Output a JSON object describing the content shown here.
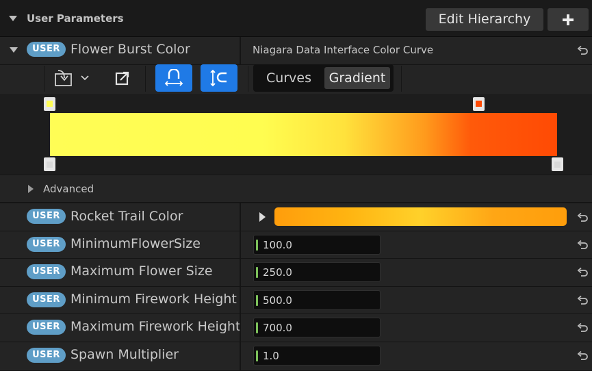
{
  "header": {
    "title": "User Parameters",
    "edit_hierarchy_label": "Edit Hierarchy",
    "add_icon": "plus-icon"
  },
  "badge_text": "USER",
  "flower_burst": {
    "label": "Flower Burst Color",
    "type_text": "Niagara Data Interface Color Curve",
    "tabs": [
      "Curves",
      "Gradient"
    ],
    "active_tab": "Gradient",
    "advanced_label": "Advanced",
    "colors": {
      "top_left_stop": "#fffd55",
      "top_right_stop": "#ff4a04",
      "bottom_stops": "#d8d8d8"
    }
  },
  "rocket_trail": {
    "label": "Rocket Trail Color"
  },
  "params": [
    {
      "label": "MinimumFlowerSize",
      "value": "100.0"
    },
    {
      "label": "Maximum Flower Size",
      "value": "250.0"
    },
    {
      "label": "Minimum Firework Height",
      "value": "500.0"
    },
    {
      "label": "Maximum Firework Height",
      "value": "700.0"
    },
    {
      "label": "Spawn Multiplier",
      "value": "1.0"
    }
  ],
  "accent": "#1f7ae6",
  "badge_color": "#5f9ec7"
}
